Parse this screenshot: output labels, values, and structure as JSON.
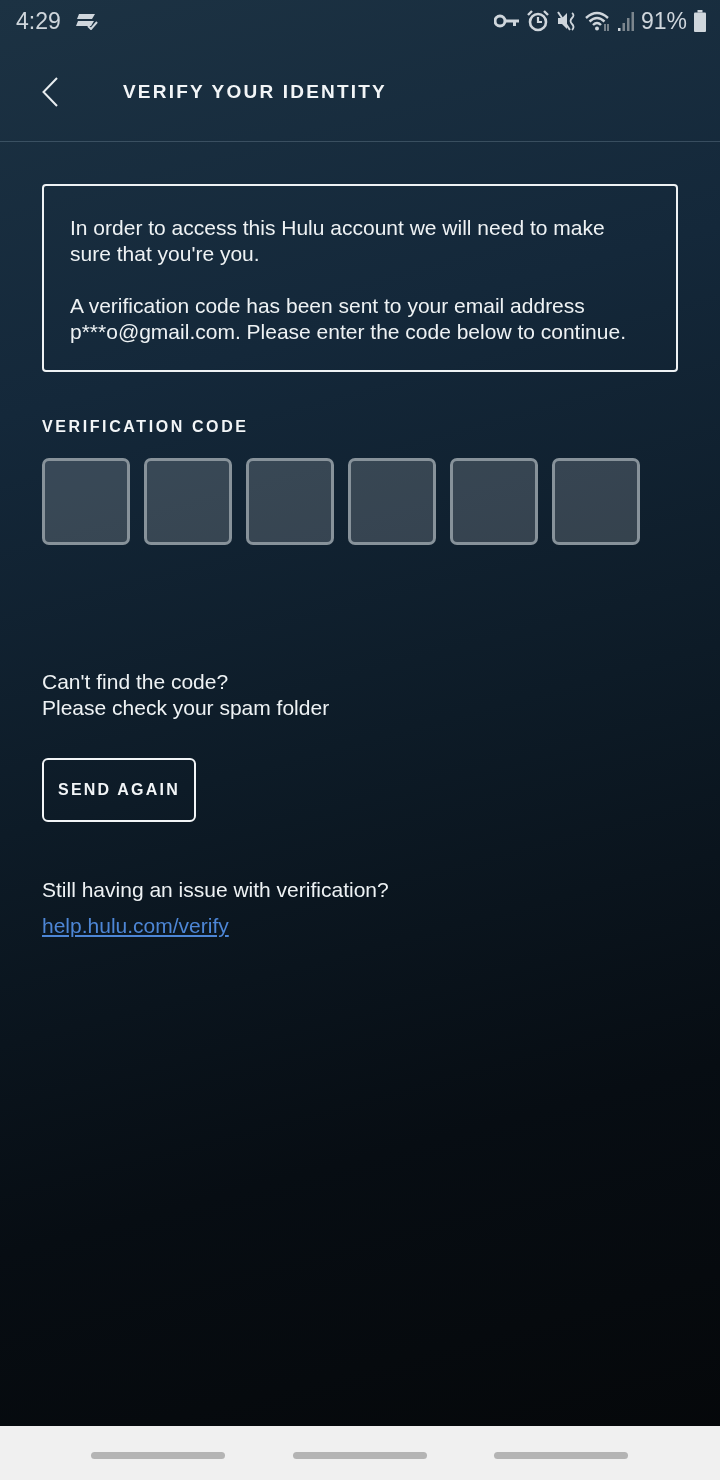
{
  "status_bar": {
    "time": "4:29",
    "battery": "91%"
  },
  "header": {
    "title": "VERIFY YOUR IDENTITY"
  },
  "info_box": {
    "paragraphs": [
      "In order to access this Hulu account we will need to make sure that you're you.",
      "A verification code has been sent to your email address p***o@gmail.com. Please enter the code below to continue."
    ]
  },
  "code_entry": {
    "label": "VERIFICATION CODE",
    "fields": [
      {
        "kind": "digit"
      },
      {
        "kind": "digit"
      },
      {
        "kind": "digit"
      },
      {
        "kind": "digit"
      },
      {
        "kind": "digit"
      },
      {
        "kind": "digit"
      }
    ]
  },
  "resend": {
    "lines": [
      "Can't find the code?",
      "Please check your spam folder"
    ],
    "button": "SEND AGAIN"
  },
  "help": {
    "text": "Still having an issue with verification?",
    "link": "help.hulu.com/verify"
  }
}
